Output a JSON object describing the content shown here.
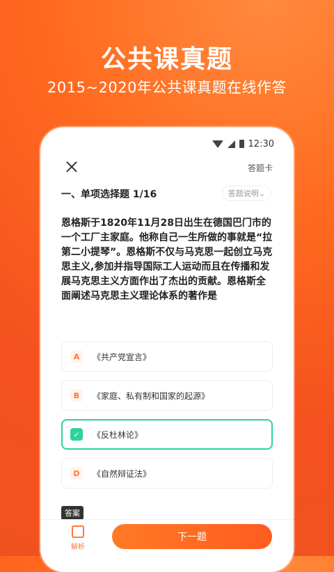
{
  "banner": {
    "title": "公共课真题",
    "subtitle": "2015~2020年公共课真题在线作答"
  },
  "status_bar": {
    "time": "12:30"
  },
  "topbar": {
    "answer_card_label": "答题卡"
  },
  "section": {
    "title": "一、单项选择题 1/16",
    "hint": "答题说明⌄"
  },
  "question": {
    "text": "恩格斯于1820年11月28日出生在德国巴门市的一个工厂主家庭。他称自己一生所做的事就是“拉第二小提琴”。恩格斯不仅与马克思一起创立马克思主义,参加并指导国际工人运动而且在传播和发展马克思主义方面作出了杰出的贡献。恩格斯全面阐述马克思主义理论体系的著作是"
  },
  "options": [
    {
      "letter": "A",
      "text": "《共产党宣言》"
    },
    {
      "letter": "B",
      "text": "《家庭、私有制和国家的起源》"
    },
    {
      "letter": "✓",
      "text": "《反杜林论》"
    },
    {
      "letter": "D",
      "text": "《自然辩证法》"
    }
  ],
  "answer_badge": "答案",
  "bottom": {
    "analysis_label": "解析",
    "next_label": "下一题"
  },
  "colors": {
    "accent": "#ff6a1f",
    "selected": "#2fd1a0"
  }
}
